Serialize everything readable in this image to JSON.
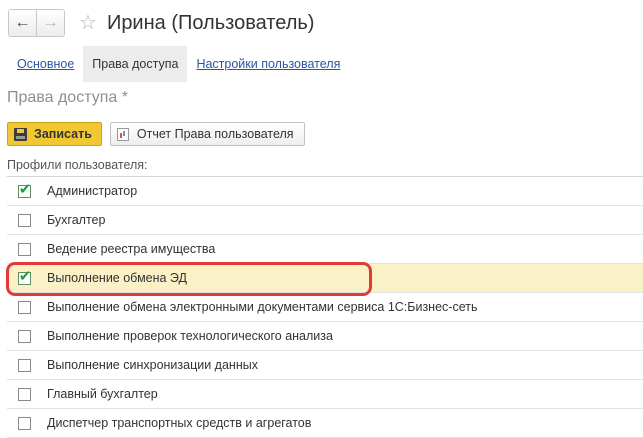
{
  "window": {
    "title": "Ирина (Пользователь)",
    "back_icon": "arrow-left-icon",
    "forward_icon": "arrow-right-icon",
    "favorite_icon": "star-icon"
  },
  "tabs": [
    {
      "label": "Основное",
      "active": false
    },
    {
      "label": "Права доступа",
      "active": true
    },
    {
      "label": "Настройки пользователя",
      "active": false
    }
  ],
  "section": {
    "title": "Права доступа *"
  },
  "toolbar": {
    "save_label": "Записать",
    "report_label": "Отчет Права пользователя"
  },
  "profiles": {
    "label": "Профили пользователя:",
    "items": [
      {
        "label": "Администратор",
        "checked": true
      },
      {
        "label": "Бухгалтер",
        "checked": false
      },
      {
        "label": "Ведение реестра имущества",
        "checked": false
      },
      {
        "label": "Выполнение обмена ЭД",
        "checked": true,
        "selected": true
      },
      {
        "label": "Выполнение обмена электронными документами сервиса 1С:Бизнес-сеть",
        "checked": false
      },
      {
        "label": "Выполнение проверок технологического анализа",
        "checked": false
      },
      {
        "label": "Выполнение синхронизации данных",
        "checked": false
      },
      {
        "label": "Главный бухгалтер",
        "checked": false
      },
      {
        "label": "Диспетчер транспортных средств и агрегатов",
        "checked": false
      }
    ]
  },
  "colors": {
    "accent_button": "#f2c832",
    "selected_row": "#fbf1c6",
    "highlight_frame": "#e03b35",
    "link": "#2b55a3"
  }
}
